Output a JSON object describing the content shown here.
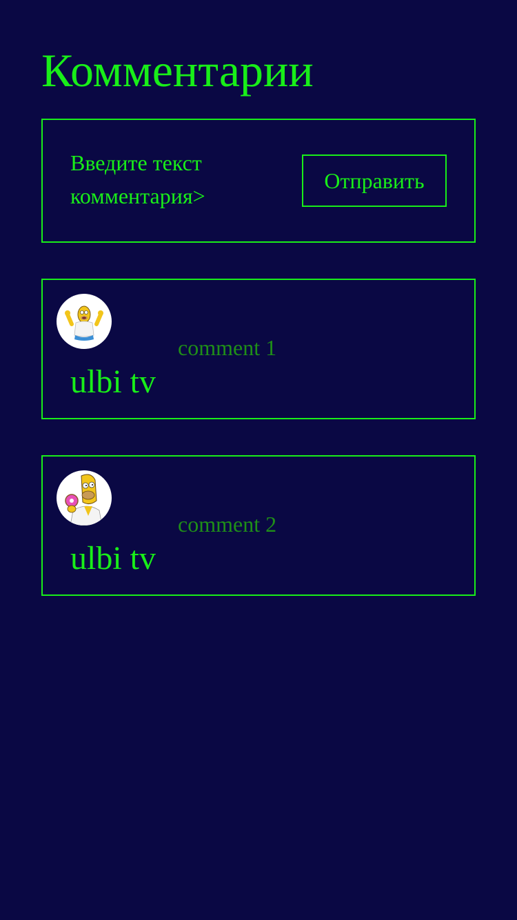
{
  "page": {
    "title": "Комментарии"
  },
  "form": {
    "input_placeholder": "Введите текст комментария>",
    "submit_label": "Отправить"
  },
  "comments": [
    {
      "author": "ulbi tv",
      "text": "comment 1",
      "avatar_icon": "homer-cheering-avatar-icon"
    },
    {
      "author": "ulbi tv",
      "text": "comment 2",
      "avatar_icon": "homer-donut-avatar-icon"
    }
  ],
  "colors": {
    "background": "#0a0844",
    "accent": "#19ee19",
    "comment_text": "#1f8f18",
    "avatar_bg": "#ffffff"
  }
}
